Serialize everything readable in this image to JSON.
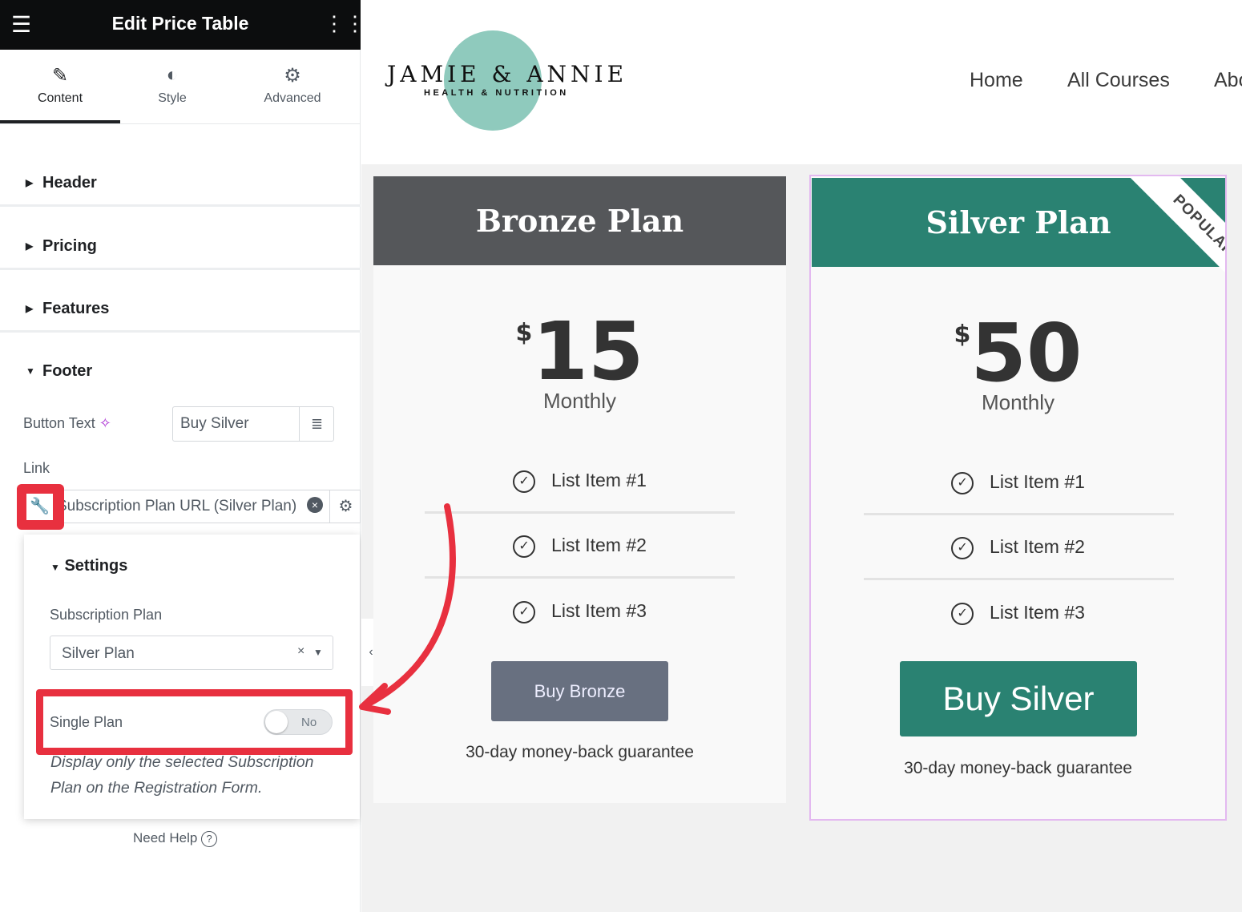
{
  "editor": {
    "title": "Edit Price Table",
    "tabs": [
      {
        "label": "Content",
        "icon": "pencil-icon"
      },
      {
        "label": "Style",
        "icon": "half-circle-icon"
      },
      {
        "label": "Advanced",
        "icon": "gear-icon"
      }
    ],
    "sections": [
      "Header",
      "Pricing",
      "Features",
      "Footer"
    ],
    "footer": {
      "button_text_label": "Button Text",
      "button_text_value": "Buy Silver",
      "link_label": "Link",
      "link_value": "Subscription Plan URL (Silver Plan)"
    },
    "settings": {
      "title": "Settings",
      "subscription_label": "Subscription Plan",
      "subscription_value": "Silver Plan",
      "single_plan_label": "Single Plan",
      "single_plan_toggle": "No",
      "description": "Display only the selected Subscription Plan on the Registration Form."
    },
    "need_help": "Need Help"
  },
  "site": {
    "logo_main": "JAMIE & ANNIE",
    "logo_sub": "HEALTH & NUTRITION",
    "nav": [
      "Home",
      "All Courses",
      "Abo"
    ],
    "plans": [
      {
        "name": "Bronze Plan",
        "currency": "$",
        "price": "15",
        "period": "Monthly",
        "items": [
          "List Item #1",
          "List Item #2",
          "List Item #3"
        ],
        "button": "Buy Bronze",
        "guarantee": "30-day money-back guarantee"
      },
      {
        "name": "Silver Plan",
        "ribbon": "POPULAR",
        "currency": "$",
        "price": "50",
        "period": "Monthly",
        "items": [
          "List Item #1",
          "List Item #2",
          "List Item #3"
        ],
        "button": "Buy Silver",
        "guarantee": "30-day money-back guarantee"
      }
    ]
  },
  "colors": {
    "teal": "#2a8272",
    "bronze_header": "#55575a",
    "bronze_button": "#687080",
    "highlight": "#e8303f"
  }
}
